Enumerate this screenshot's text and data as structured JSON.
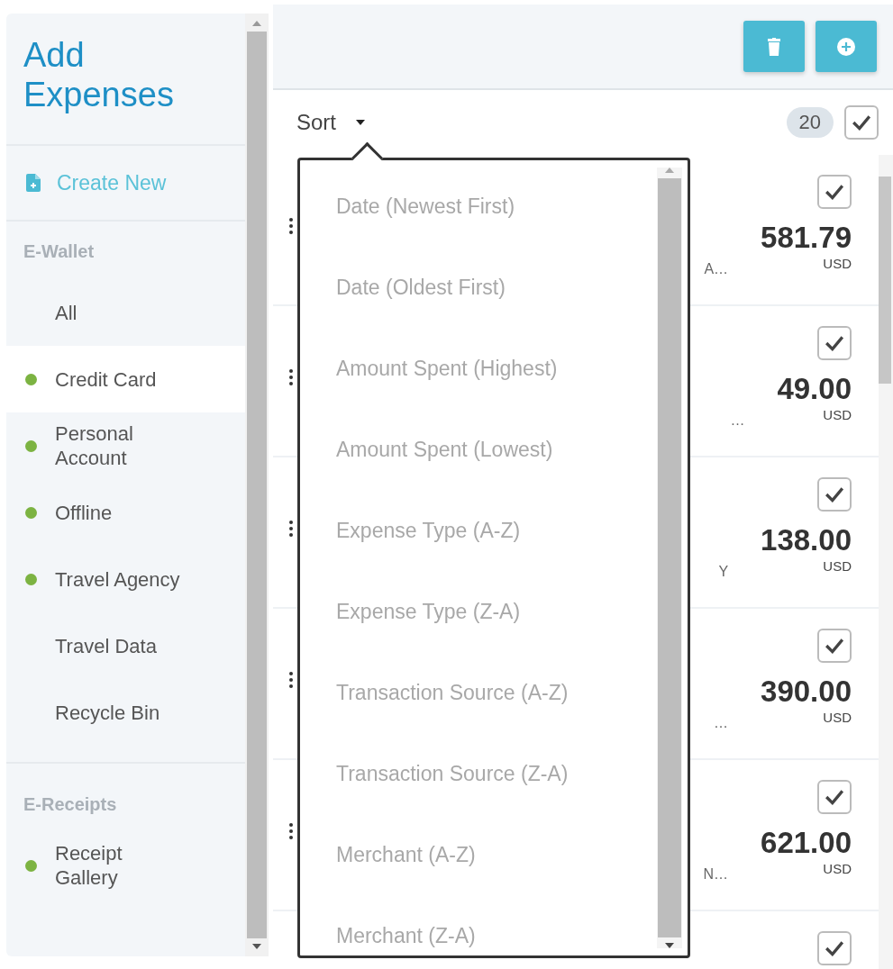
{
  "sidebar": {
    "title": "Add Expenses",
    "create_new": "Create New",
    "sections": [
      {
        "heading": "E-Wallet",
        "items": [
          {
            "label": "All",
            "selected": false
          },
          {
            "label": "Credit Card",
            "selected": true,
            "color": "#7cb342"
          },
          {
            "label": "Personal Account",
            "selected": false,
            "color": "#7cb342"
          },
          {
            "label": "Offline",
            "selected": false,
            "color": "#7cb342"
          },
          {
            "label": "Travel Agency",
            "selected": false,
            "color": "#7cb342"
          },
          {
            "label": "Travel Data",
            "selected": false
          },
          {
            "label": "Recycle Bin",
            "selected": false
          }
        ]
      },
      {
        "heading": "E-Receipts",
        "items": [
          {
            "label": "Receipt Gallery",
            "selected": false,
            "color": "#7cb342"
          }
        ]
      }
    ]
  },
  "toolbar": {
    "buttons": [
      {
        "kind": "delete"
      },
      {
        "kind": "add"
      }
    ]
  },
  "sort": {
    "label": "Sort",
    "count": "20",
    "select_all_checked": true,
    "menu_open": true,
    "options": [
      "Date (Newest First)",
      "Date (Oldest First)",
      "Amount Spent (Highest)",
      "Amount Spent (Lowest)",
      "Expense Type (A-Z)",
      "Expense Type (Z-A)",
      "Transaction Source (A-Z)",
      "Transaction Source (Z-A)",
      "Merchant (A-Z)",
      "Merchant (Z-A)"
    ]
  },
  "expenses": [
    {
      "snippet": "A…",
      "amount": "581.79",
      "currency": "USD",
      "checked": true
    },
    {
      "snippet": "…",
      "amount": "49.00",
      "currency": "USD",
      "checked": true
    },
    {
      "snippet": "Y",
      "amount": "138.00",
      "currency": "USD",
      "checked": true
    },
    {
      "snippet": "…",
      "amount": "390.00",
      "currency": "USD",
      "checked": true
    },
    {
      "snippet": "N…",
      "amount": "621.00",
      "currency": "USD",
      "checked": true
    },
    {
      "checked": true
    }
  ]
}
